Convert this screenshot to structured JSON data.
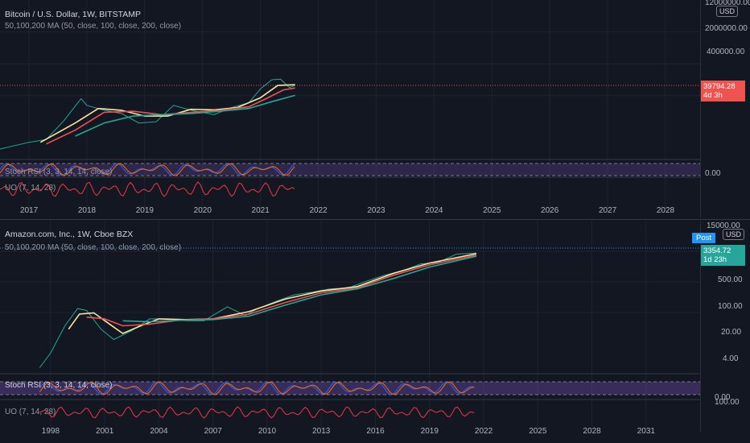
{
  "chart_data": [
    {
      "type": "line",
      "title": "Bitcoin / U.S. Dollar, 1W, BITSTAMP",
      "subtitle": "50,100,200 MA (50, close, 100, close, 200, close)",
      "x_ticks": [
        "2017",
        "2018",
        "2019",
        "2020",
        "2021",
        "2022",
        "2023",
        "2024",
        "2025",
        "2026",
        "2027",
        "2028"
      ],
      "y_ticks": [
        "12000000.00",
        "2000000.00",
        "400000.00"
      ],
      "y_scale": "log",
      "currency_button": "USD",
      "last_price": "39794.28",
      "countdown": "4d 3h",
      "indicators": [
        {
          "name": "Stoch RSI (3, 3, 14, 14, close)",
          "level": "0.00"
        },
        {
          "name": "UO (7, 14, 28)"
        }
      ],
      "series": [
        {
          "name": "price",
          "color": "#26a69a",
          "x": [
            2016.5,
            2017.0,
            2017.3,
            2017.6,
            2017.9,
            2018.0,
            2018.3,
            2018.6,
            2018.9,
            2019.2,
            2019.5,
            2019.8,
            2020.2,
            2020.5,
            2020.8,
            2021.0,
            2021.2,
            2021.35,
            2021.5,
            2021.6
          ],
          "y": [
            650,
            1000,
            1200,
            4000,
            17000,
            11000,
            8000,
            6500,
            3500,
            3800,
            11000,
            8000,
            6000,
            9500,
            13000,
            32000,
            58000,
            60000,
            35000,
            39794
          ]
        },
        {
          "name": "MA50",
          "color": "#f9e79f",
          "x": [
            2017.2,
            2017.8,
            2018.2,
            2018.6,
            2019.0,
            2019.4,
            2019.8,
            2020.2,
            2020.6,
            2021.0,
            2021.3,
            2021.6
          ],
          "y": [
            1000,
            3500,
            9000,
            8000,
            5500,
            5500,
            8500,
            8200,
            9500,
            18000,
            40000,
            42000
          ]
        },
        {
          "name": "MA100",
          "color": "#ef5350",
          "x": [
            2017.3,
            2017.8,
            2018.3,
            2018.8,
            2019.3,
            2019.8,
            2020.3,
            2020.8,
            2021.1,
            2021.4,
            2021.6
          ],
          "y": [
            900,
            2200,
            7000,
            7500,
            6000,
            7000,
            8000,
            10000,
            17000,
            30000,
            34000
          ]
        },
        {
          "name": "MA200",
          "color": "#26a69a",
          "x": [
            2017.8,
            2018.3,
            2018.8,
            2019.3,
            2019.8,
            2020.3,
            2020.8,
            2021.2,
            2021.6
          ],
          "y": [
            1500,
            3500,
            5500,
            6000,
            6500,
            7500,
            9000,
            14000,
            21000
          ]
        }
      ]
    },
    {
      "type": "line",
      "title": "Amazon.com, Inc., 1W, Cboe BZX",
      "subtitle": "50,100,200 MA (50, close, 100, close, 200, close)",
      "x_ticks": [
        "1998",
        "2001",
        "2004",
        "2007",
        "2010",
        "2013",
        "2016",
        "2019",
        "2022",
        "2025",
        "2028",
        "2031"
      ],
      "y_ticks": [
        "15000.00",
        "500.00",
        "100.00",
        "20.00",
        "4.00"
      ],
      "y_scale": "log",
      "currency_button": "USD",
      "post_badge": "Post",
      "last_price": "3354.72",
      "countdown": "1d 23h",
      "indicators": [
        {
          "name": "Stoch RSI (3, 3, 14, 14, close)",
          "level": "0.00"
        },
        {
          "name": "UO (7, 14, 28)",
          "level": "100.00"
        }
      ],
      "series": [
        {
          "name": "price",
          "color": "#26a69a",
          "x": [
            1997.4,
            1998.0,
            1998.8,
            1999.5,
            2000.0,
            2000.8,
            2001.5,
            2002.5,
            2003.5,
            2004.5,
            2005.5,
            2006.5,
            2007.8,
            2008.8,
            2009.5,
            2010.5,
            2011.5,
            2012.5,
            2013.5,
            2014.5,
            2015.5,
            2016.5,
            2017.5,
            2018.5,
            2019.5,
            2020.5,
            2021.0,
            2021.6
          ],
          "y": [
            1.5,
            4,
            25,
            80,
            70,
            20,
            10,
            18,
            40,
            40,
            35,
            35,
            90,
            50,
            80,
            130,
            200,
            240,
            300,
            320,
            500,
            750,
            1000,
            1600,
            1800,
            3100,
            3200,
            3355
          ]
        },
        {
          "name": "MA50",
          "color": "#f9e79f",
          "x": [
            1999.0,
            1999.6,
            2000.4,
            2001.2,
            2002.0,
            2003.0,
            2004.0,
            2005.5,
            2007.0,
            2009.0,
            2011.0,
            2013.0,
            2015.0,
            2017.0,
            2019.0,
            2021.6
          ],
          "y": [
            20,
            55,
            60,
            30,
            15,
            25,
            40,
            38,
            40,
            65,
            150,
            260,
            350,
            850,
            1700,
            3200
          ]
        },
        {
          "name": "MA100",
          "color": "#ef5350",
          "x": [
            2000.0,
            2001.0,
            2002.0,
            2003.5,
            2005.0,
            2007.0,
            2009.0,
            2011.0,
            2013.0,
            2015.0,
            2017.0,
            2019.0,
            2021.6
          ],
          "y": [
            45,
            40,
            25,
            28,
            36,
            40,
            55,
            120,
            230,
            320,
            750,
            1500,
            2900
          ]
        },
        {
          "name": "MA200",
          "color": "#26a69a",
          "x": [
            2002.0,
            2003.5,
            2005.0,
            2007.0,
            2009.0,
            2011.0,
            2013.0,
            2015.0,
            2017.0,
            2019.0,
            2021.6
          ],
          "y": [
            35,
            33,
            36,
            38,
            48,
            100,
            200,
            300,
            600,
            1300,
            2700
          ]
        }
      ]
    }
  ]
}
